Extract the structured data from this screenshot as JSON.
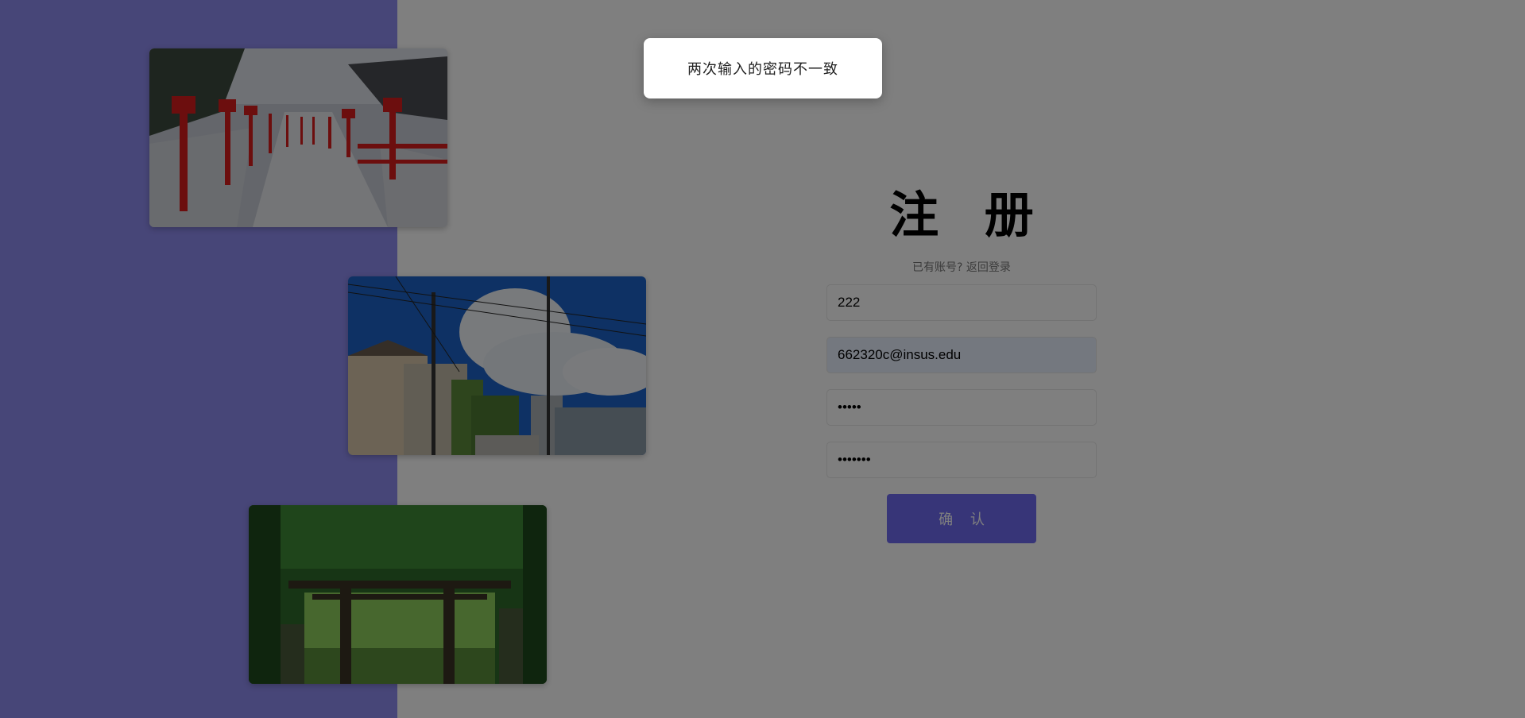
{
  "register": {
    "title": "注 册",
    "login_link": "已有账号? 返回登录",
    "username_value": "222",
    "email_value": "662320c@insus.edu",
    "password_value": "•••••",
    "confirm_password_value": "•••••••",
    "confirm_button": "确 认"
  },
  "toast": {
    "message": "两次输入的密码不一致"
  },
  "photos": [
    {
      "name": "snowy-lantern-stairs-photo"
    },
    {
      "name": "summer-street-clouds-photo"
    },
    {
      "name": "forest-torii-gate-photo"
    }
  ],
  "colors": {
    "left_panel": "#8f8cf0",
    "button": "#6f6bf0",
    "overlay": "rgba(0,0,0,0.5)"
  }
}
